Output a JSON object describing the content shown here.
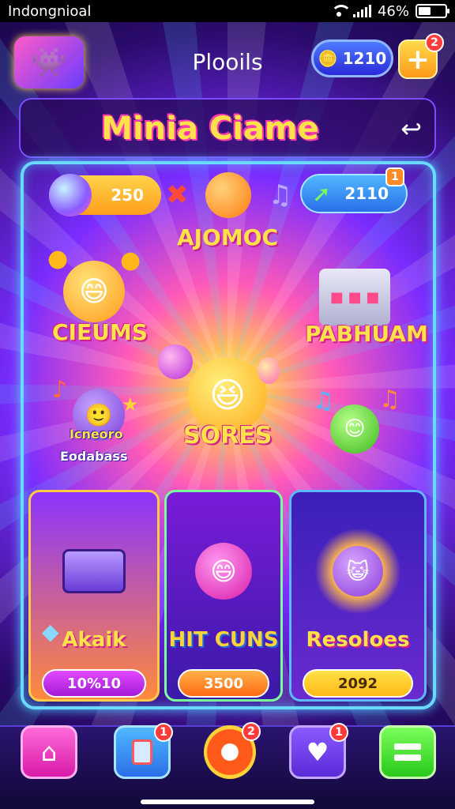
{
  "status_bar": {
    "carrier": "Indongnioal",
    "battery_text": "46%",
    "battery_level": 0.46
  },
  "header": {
    "title": "Plooils",
    "coins": "1210",
    "add_label": "+",
    "add_badge": "2"
  },
  "banner": {
    "title": "Minia Ciame"
  },
  "stats": {
    "left_value": "250",
    "right_value": "2110",
    "right_badge": "1"
  },
  "subtitle": "AJOMOC",
  "mascots": {
    "left_top_label": "CIEUMS",
    "right_top_label": "PABHUAM",
    "center_label": "SORES",
    "left_mid_label_1": "Icneoro",
    "left_mid_label_2": "Eodabass"
  },
  "cards": [
    {
      "label": "Akaik",
      "value": "10%10"
    },
    {
      "label": "HIT CUNS",
      "value": "3500"
    },
    {
      "label": "Resoloes",
      "value": "2092"
    }
  ],
  "nav": {
    "cards_badge": "1",
    "target_badge": "2",
    "chat_badge": "1"
  },
  "colors": {
    "accent_yellow": "#ffe14a",
    "accent_pink": "#d11f8c",
    "panel_border": "#6ad8ff"
  }
}
